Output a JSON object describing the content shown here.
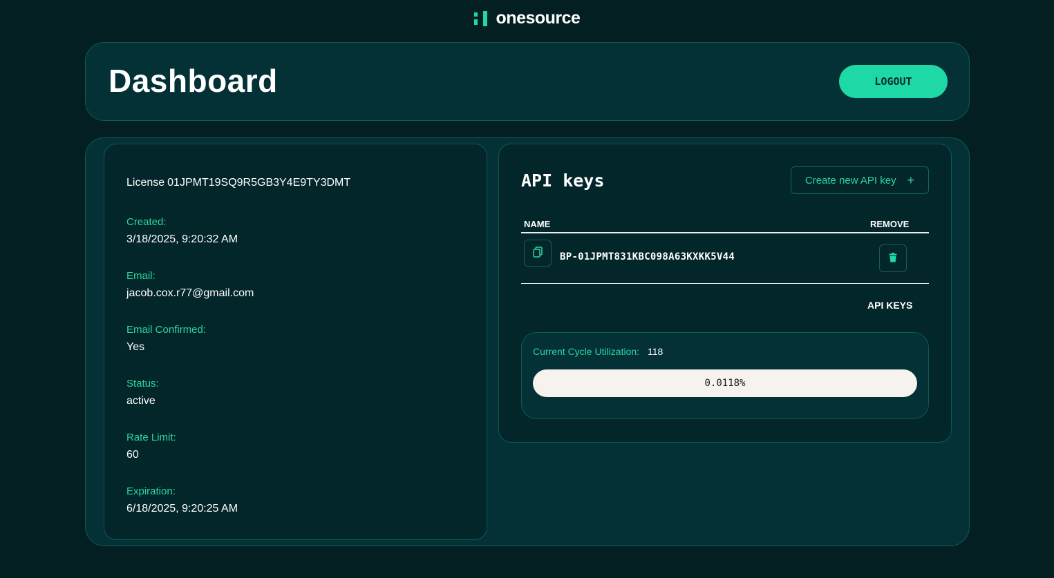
{
  "brand": {
    "name": "onesource",
    "accent": "#1ed8a6"
  },
  "header": {
    "title": "Dashboard",
    "logout_label": "LOGOUT"
  },
  "license": {
    "prefix": "License",
    "id": "01JPMT19SQ9R5GB3Y4E9TY3DMT",
    "fields": [
      {
        "label": "Created:",
        "value": "3/18/2025, 9:20:32 AM"
      },
      {
        "label": "Email:",
        "value": "jacob.cox.r77@gmail.com"
      },
      {
        "label": "Email Confirmed:",
        "value": "Yes"
      },
      {
        "label": "Status:",
        "value": "active"
      },
      {
        "label": "Rate Limit:",
        "value": "60"
      },
      {
        "label": "Expiration:",
        "value": "6/18/2025, 9:20:25 AM"
      }
    ]
  },
  "api_keys": {
    "title": "API keys",
    "create_label": "Create new API key",
    "create_icon": "plus-icon",
    "columns": {
      "name": "NAME",
      "remove": "REMOVE"
    },
    "keys": [
      {
        "name": "BP-01JPMT831KBC098A63KXKK5V44",
        "copy_icon": "copy-icon",
        "remove_icon": "trash-icon"
      }
    ],
    "caption": "API KEYS"
  },
  "utilization": {
    "label": "Current Cycle Utilization:",
    "value": "118",
    "percent_text": "0.0118%",
    "percent": 0.0118
  }
}
